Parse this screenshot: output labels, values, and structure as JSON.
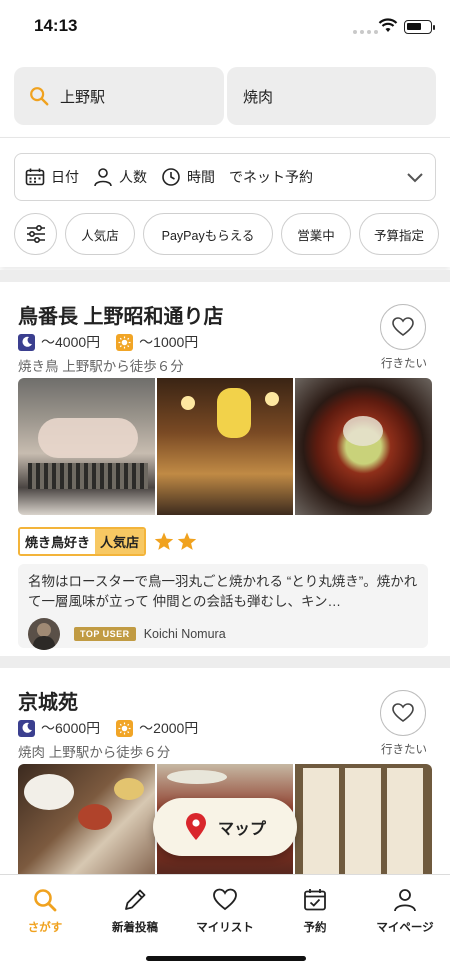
{
  "status_bar": {
    "time": "14:13"
  },
  "search": {
    "location": "上野駅",
    "keyword": "焼肉"
  },
  "quick_filters": {
    "date": "日付",
    "people": "人数",
    "time": "時間",
    "net_reserve": "でネット予約"
  },
  "chips": [
    "人気店",
    "PayPayもらえる",
    "営業中",
    "予算指定"
  ],
  "restaurants": [
    {
      "name": "鳥番長 上野昭和通り店",
      "dinner_price": "～4000円",
      "lunch_price": "～1000円",
      "meta": "焼き鳥  上野駅から徒歩６分",
      "fav_label": "行きたい",
      "tags": [
        "焼き鳥好き",
        "人気店"
      ],
      "stars": 2,
      "review": "名物はロースターで鳥一羽丸ごと焼かれる “とり丸焼き”。焼かれて一層風味が立って 仲間との会話も弾むし、キン…",
      "top_user_label": "TOP USER",
      "reviewer": "Koichi  Nomura"
    },
    {
      "name": "京城苑",
      "dinner_price": "～6000円",
      "lunch_price": "～2000円",
      "meta": "焼肉  上野駅から徒歩６分",
      "fav_label": "行きたい"
    }
  ],
  "map_button": "マップ",
  "tabs": [
    {
      "label": "さがす",
      "icon": "search-icon",
      "active": true
    },
    {
      "label": "新着投稿",
      "icon": "pencil-icon"
    },
    {
      "label": "マイリスト",
      "icon": "heart-icon"
    },
    {
      "label": "予約",
      "icon": "calendar-check-icon"
    },
    {
      "label": "マイページ",
      "icon": "person-icon"
    }
  ],
  "colors": {
    "accent": "#f0a21f",
    "night_badge": "#3b3f8f",
    "day_badge": "#f1a526",
    "tag_highlight": "#f7c863",
    "top_user": "#c19b43"
  }
}
